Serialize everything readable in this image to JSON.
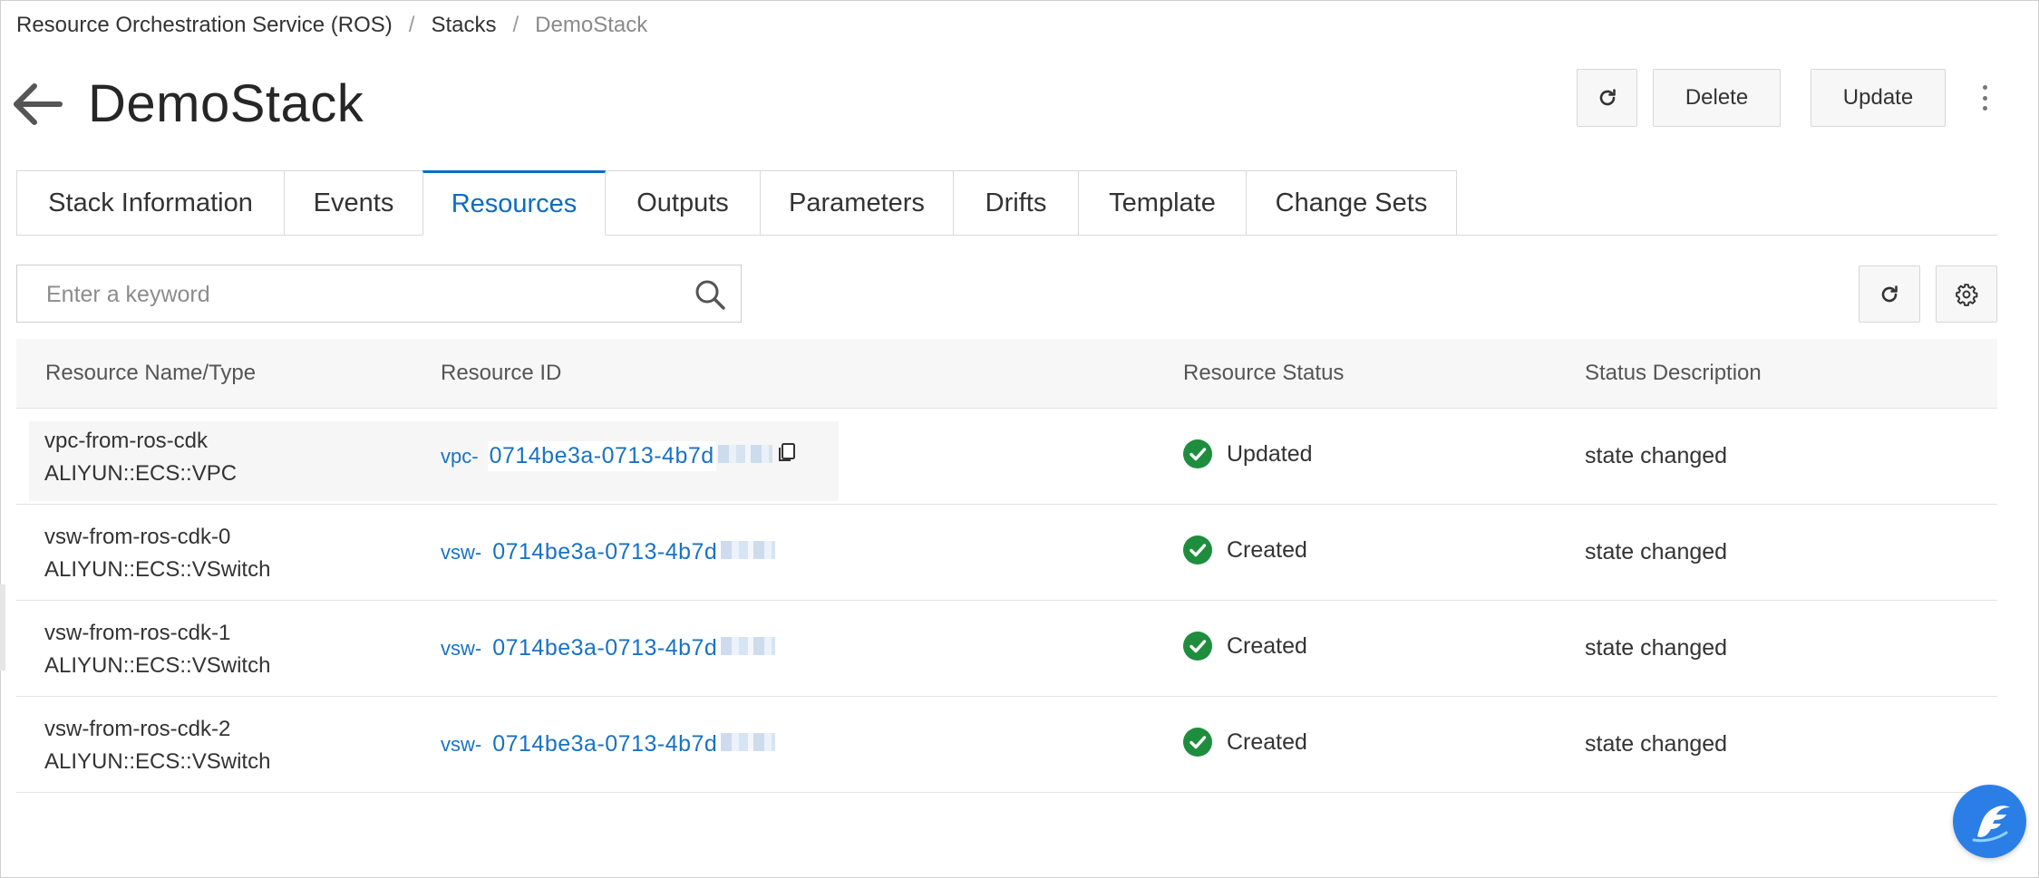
{
  "breadcrumb": {
    "items": [
      "Resource Orchestration Service (ROS)",
      "Stacks",
      "DemoStack"
    ],
    "separator": "/"
  },
  "header": {
    "title": "DemoStack",
    "buttons": {
      "delete": "Delete",
      "update": "Update"
    }
  },
  "tabs": [
    {
      "label": "Stack Information",
      "active": false
    },
    {
      "label": "Events",
      "active": false
    },
    {
      "label": "Resources",
      "active": true
    },
    {
      "label": "Outputs",
      "active": false
    },
    {
      "label": "Parameters",
      "active": false
    },
    {
      "label": "Drifts",
      "active": false
    },
    {
      "label": "Template",
      "active": false
    },
    {
      "label": "Change Sets",
      "active": false
    }
  ],
  "search": {
    "placeholder": "Enter a keyword",
    "value": ""
  },
  "table": {
    "columns": [
      "Resource Name/Type",
      "Resource ID",
      "Resource Status",
      "Status Description"
    ],
    "rows": [
      {
        "name": "vpc-from-ros-cdk",
        "type": "ALIYUN::ECS::VPC",
        "id_prefix": "vpc-",
        "id": "0714be3a-0713-4b7d",
        "status": "Updated",
        "description": "state changed"
      },
      {
        "name": "vsw-from-ros-cdk-0",
        "type": "ALIYUN::ECS::VSwitch",
        "id_prefix": "vsw-",
        "id": "0714be3a-0713-4b7d",
        "status": "Created",
        "description": "state changed"
      },
      {
        "name": "vsw-from-ros-cdk-1",
        "type": "ALIYUN::ECS::VSwitch",
        "id_prefix": "vsw-",
        "id": "0714be3a-0713-4b7d",
        "status": "Created",
        "description": "state changed"
      },
      {
        "name": "vsw-from-ros-cdk-2",
        "type": "ALIYUN::ECS::VSwitch",
        "id_prefix": "vsw-",
        "id": "0714be3a-0713-4b7d",
        "status": "Created",
        "description": "state changed"
      }
    ]
  },
  "colors": {
    "accent": "#0b6cc2",
    "link": "#1872c6",
    "success": "#1e8e3e",
    "floating_button": "#2b7ee6"
  },
  "icons": {
    "back": "arrow-left-icon",
    "refresh": "refresh-icon",
    "more": "more-vertical-icon",
    "search": "search-icon",
    "settings": "gear-icon",
    "copy": "copy-icon",
    "status": "check-circle-icon",
    "floating": "assistant-logo-icon"
  }
}
